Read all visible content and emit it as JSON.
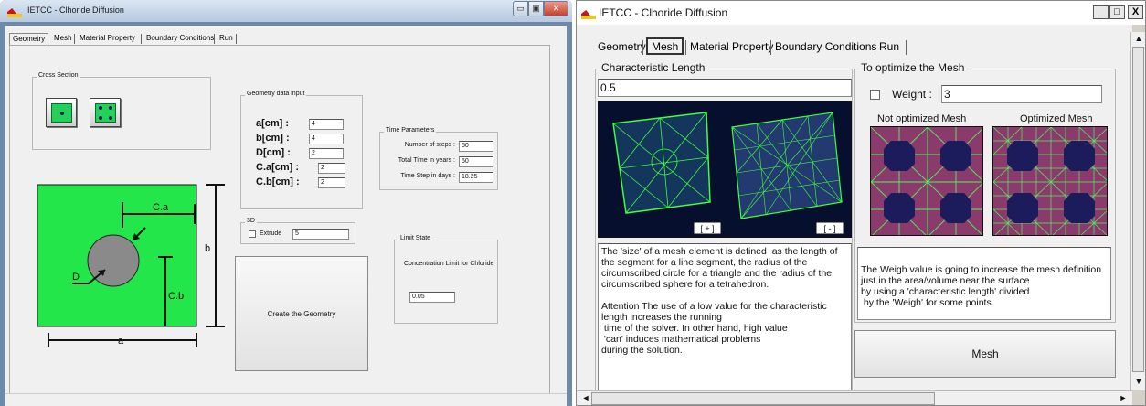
{
  "left_window": {
    "title": "IETCC - Clhoride Diffusion",
    "controls": {
      "minimize": "▭",
      "maximize": "▣",
      "close": "✕"
    },
    "tabs": [
      "Geometry",
      "Mesh",
      "Material Property",
      "Boundary Conditions",
      "Run"
    ],
    "active_tab": "Geometry",
    "cross_section": {
      "title": "Cross Section"
    },
    "geometry_input": {
      "title": "Geometry data input",
      "fields": [
        {
          "label": "a[cm] :",
          "value": "4"
        },
        {
          "label": "b[cm] :",
          "value": "4"
        },
        {
          "label": "D[cm] :",
          "value": "2"
        },
        {
          "label": "C.a[cm] :",
          "value": "2"
        },
        {
          "label": "C.b[cm] :",
          "value": "2"
        }
      ]
    },
    "time_params": {
      "title": "Time Parameters",
      "fields": [
        {
          "label": "Number of steps :",
          "value": "50"
        },
        {
          "label": "Total Time in years :",
          "value": "50"
        },
        {
          "label": "Time Step in days :",
          "value": "18.25"
        }
      ]
    },
    "three_d": {
      "title": "3D",
      "extrude_label": "Extrude",
      "extrude_value": "5"
    },
    "limit_state": {
      "title": "Limit State",
      "label": "Concentration Limit for Chloride",
      "value": "0.05"
    },
    "create_button": "Create the Geometry",
    "diagram": {
      "ca": "C.a",
      "cb": "C.b",
      "d": "D",
      "a": "a",
      "b": "b"
    }
  },
  "right_window": {
    "title": "IETCC - Clhoride Diffusion",
    "controls": {
      "minimize": "_",
      "maximize": "□",
      "close": "X"
    },
    "tabs": [
      "Geometry",
      "Mesh",
      "Material Property",
      "Boundary Conditions",
      "Run"
    ],
    "active_tab": "Mesh",
    "char_length": {
      "title": "Characteristic Length",
      "value": "0.5",
      "zoom_in": "[ + ]",
      "zoom_out": "[ - ]",
      "description": "The 'size' of a mesh element is defined  as the length of the segment for a line segment, the radius of the circumscribed circle for a triangle and the radius of the circumscribed sphere for a tetrahedron.\n\nAttention The use of a low value for the characteristic length increases the running\n time of the solver. In other hand, high value\n 'can' induces mathematical problems\nduring the solution."
    },
    "optimize": {
      "title": "To optimize the Mesh",
      "weight_label": "Weight :",
      "weight_value": "3",
      "not_optimized": "Not optimized Mesh",
      "optimized": "Optimized Mesh",
      "description": "The Weigh value is going to increase the mesh definition just in the area/volume near the surface\nby using a 'characteristic length' divided\n by the 'Weigh' for some points."
    },
    "mesh_button": "Mesh",
    "scroll": {
      "up": "▲",
      "down": "▼",
      "left": "◄",
      "right": "►"
    }
  },
  "colors": {
    "green": "#22e64a",
    "mesh_bg": "#8a3b6c",
    "mesh_line": "#54f060",
    "hole": "#1c1c5c",
    "dark_bg": "#06102e"
  }
}
